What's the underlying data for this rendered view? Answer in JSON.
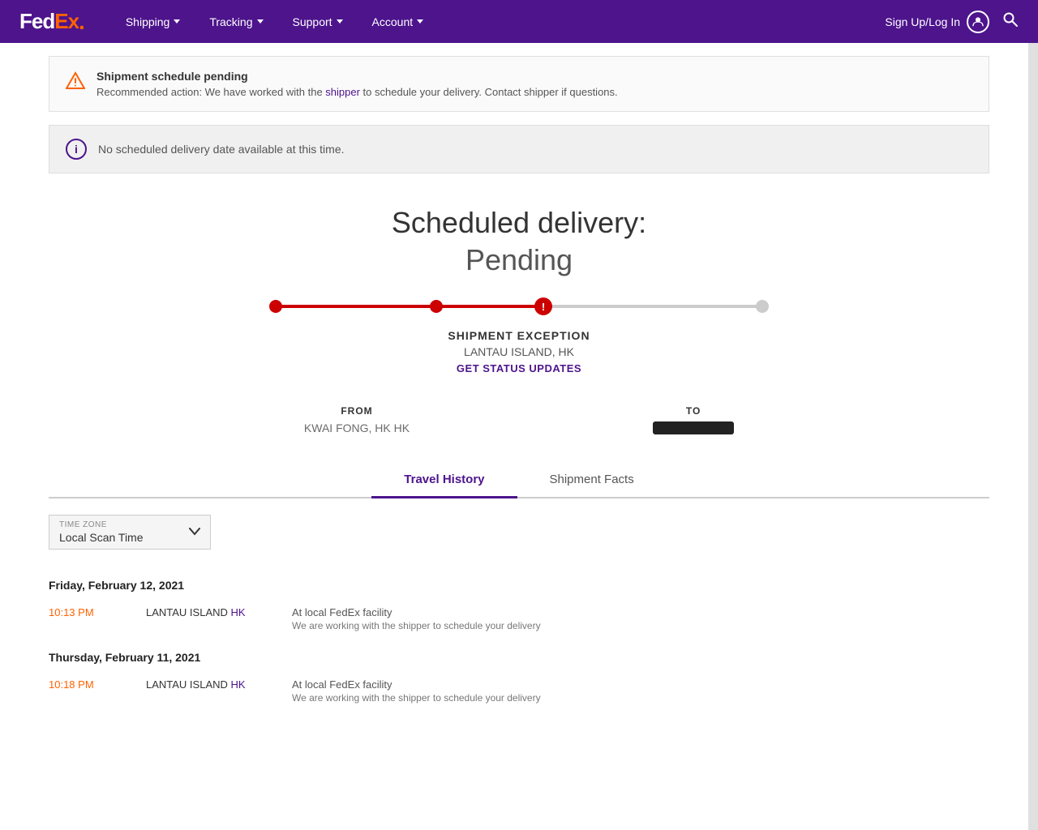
{
  "header": {
    "logo_fed": "Fed",
    "logo_ex": "Ex",
    "logo_dot": ".",
    "nav": [
      {
        "label": "Shipping",
        "id": "shipping"
      },
      {
        "label": "Tracking",
        "id": "tracking"
      },
      {
        "label": "Support",
        "id": "support"
      },
      {
        "label": "Account",
        "id": "account"
      }
    ],
    "sign_in": "Sign Up/Log In",
    "search_placeholder": "Search"
  },
  "alert": {
    "title": "Shipment schedule pending",
    "text": "Recommended action: We have worked with the shipper to schedule your delivery. Contact shipper if questions.",
    "link_text": "shipper"
  },
  "info": {
    "text": "No scheduled delivery date available at this time."
  },
  "delivery": {
    "title": "Scheduled delivery:",
    "status": "Pending"
  },
  "progress": {
    "dots": [
      {
        "type": "filled",
        "position": "0%"
      },
      {
        "type": "filled",
        "position": "33%"
      },
      {
        "type": "exception",
        "position": "55%",
        "icon": "!"
      },
      {
        "type": "empty",
        "position": "100%"
      }
    ]
  },
  "shipment": {
    "exception_label": "SHIPMENT EXCEPTION",
    "location": "LANTAU ISLAND, HK",
    "updates_link": "GET STATUS UPDATES"
  },
  "from_to": {
    "from_label": "FROM",
    "from_value": "KWAI FONG, HK HK",
    "to_label": "TO"
  },
  "tabs": [
    {
      "label": "Travel History",
      "id": "travel-history",
      "active": true
    },
    {
      "label": "Shipment Facts",
      "id": "shipment-facts",
      "active": false
    }
  ],
  "timezone": {
    "label": "TIME ZONE",
    "value": "Local Scan Time",
    "chevron": "∨"
  },
  "travel_history": [
    {
      "date": "Friday, February 12, 2021",
      "events": [
        {
          "time": "10:13 PM",
          "location_city": "LANTAU ISLAND",
          "location_country": " HK",
          "description": "At local FedEx facility",
          "sub_description": "We are working with the shipper to schedule your delivery"
        }
      ]
    },
    {
      "date": "Thursday, February 11, 2021",
      "events": [
        {
          "time": "10:18 PM",
          "location_city": "LANTAU ISLAND",
          "location_country": " HK",
          "description": "At local FedEx facility",
          "sub_description": "We are working with the shipper to schedule your delivery"
        }
      ]
    }
  ]
}
